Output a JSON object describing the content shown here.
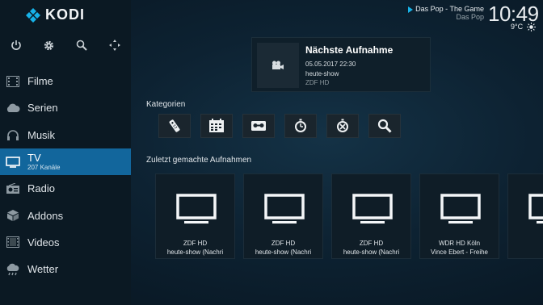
{
  "app": {
    "logo_text": "KODI"
  },
  "top_icons": [
    "power-icon",
    "gear-icon",
    "search-icon",
    "fullscreen-icon"
  ],
  "sidebar": {
    "items": [
      {
        "label": "Filme",
        "icon": "film-icon"
      },
      {
        "label": "Serien",
        "icon": "cloud-icon"
      },
      {
        "label": "Musik",
        "icon": "headphones-icon"
      },
      {
        "label": "TV",
        "sublabel": "207 Kanäle",
        "icon": "tv-icon",
        "active": true
      },
      {
        "label": "Radio",
        "icon": "radio-icon"
      },
      {
        "label": "Addons",
        "icon": "addons-box-icon"
      },
      {
        "label": "Videos",
        "icon": "video-strip-icon"
      },
      {
        "label": "Wetter",
        "icon": "weather-icon"
      }
    ]
  },
  "now_playing": {
    "title": "Das Pop - The Game",
    "channel": "Das Pop"
  },
  "clock": {
    "time": "10:49",
    "temperature": "9°C"
  },
  "next_recording": {
    "heading": "Nächste Aufnahme",
    "date": "05.05.2017 22:30",
    "show": "heute-show",
    "channel": "ZDF HD"
  },
  "categories": {
    "heading": "Kategorien",
    "items": [
      "remote-icon",
      "epg-guide-icon",
      "recordings-icon",
      "timer-icon",
      "timer-rules-icon",
      "search-icon"
    ]
  },
  "recent_recordings": {
    "heading": "Zuletzt gemachte Aufnahmen",
    "items": [
      {
        "channel": "ZDF HD",
        "program": "heute-show (Nachri"
      },
      {
        "channel": "ZDF HD",
        "program": "heute-show (Nachri"
      },
      {
        "channel": "ZDF HD",
        "program": "heute-show (Nachri"
      },
      {
        "channel": "WDR HD Köln",
        "program": "Vince Ebert - Freihe"
      },
      {
        "channel": "",
        "program": ""
      }
    ]
  },
  "colors": {
    "accent": "#12669c",
    "background": "#0d2232",
    "sidebar": "#0b1923"
  }
}
